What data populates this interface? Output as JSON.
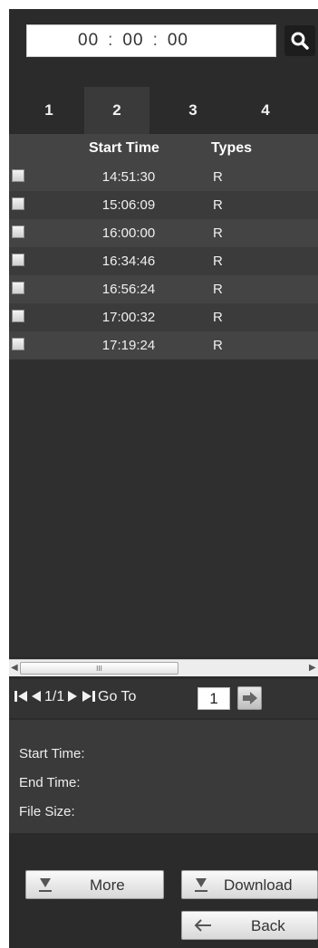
{
  "search": {
    "hh": "00",
    "mm": "00",
    "ss": "00",
    "sep": ":"
  },
  "tabs": [
    {
      "label": "1"
    },
    {
      "label": "2"
    },
    {
      "label": "3"
    },
    {
      "label": "4"
    }
  ],
  "list": {
    "headers": {
      "start_time": "Start Time",
      "types": "Types"
    },
    "rows": [
      {
        "time": "14:51:30",
        "type": "R"
      },
      {
        "time": "15:06:09",
        "type": "R"
      },
      {
        "time": "16:00:00",
        "type": "R"
      },
      {
        "time": "16:34:46",
        "type": "R"
      },
      {
        "time": "16:56:24",
        "type": "R"
      },
      {
        "time": "17:00:32",
        "type": "R"
      },
      {
        "time": "17:19:24",
        "type": "R"
      }
    ]
  },
  "scrollbar": {
    "grip": "III"
  },
  "pager": {
    "indicator": "1/1",
    "goto_label": "Go To",
    "page_value": "1"
  },
  "info": {
    "start_time": "Start Time:",
    "end_time": "End Time:",
    "file_size": "File Size:"
  },
  "buttons": {
    "more": "More",
    "download": "Download",
    "back": "Back"
  }
}
